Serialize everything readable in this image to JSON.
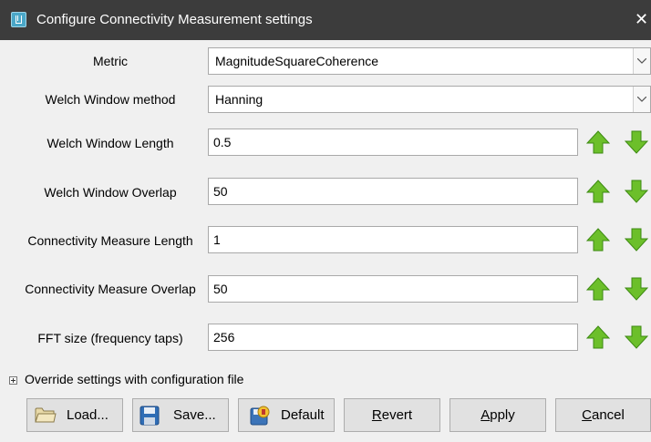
{
  "window": {
    "title": "Configure Connectivity Measurement settings",
    "close_glyph": "✕"
  },
  "settings": {
    "metric": {
      "label": "Metric",
      "value": "MagnitudeSquareCoherence"
    },
    "welch_window_method": {
      "label": "Welch Window method",
      "value": "Hanning"
    },
    "welch_window_length": {
      "label": "Welch Window Length",
      "value": "0.5"
    },
    "welch_window_overlap": {
      "label": "Welch Window Overlap",
      "value": "50"
    },
    "connectivity_measure_length": {
      "label": "Connectivity Measure Length",
      "value": "1"
    },
    "connectivity_measure_overlap": {
      "label": "Connectivity Measure Overlap",
      "value": "50"
    },
    "fft_size": {
      "label": "FFT size (frequency taps)",
      "value": "256"
    }
  },
  "expander": {
    "label": "Override settings with configuration file"
  },
  "buttons": {
    "load": "Load...",
    "save": "Save...",
    "default": "Default",
    "revert_mnemonic": "R",
    "revert_rest": "evert",
    "apply_mnemonic": "A",
    "apply_rest": "pply",
    "cancel_mnemonic": "C",
    "cancel_rest": "ancel"
  },
  "colors": {
    "titlebar": "#3c3c3c",
    "arrow_green": "#66bb22",
    "dialog_bg": "#f0f0f0"
  }
}
